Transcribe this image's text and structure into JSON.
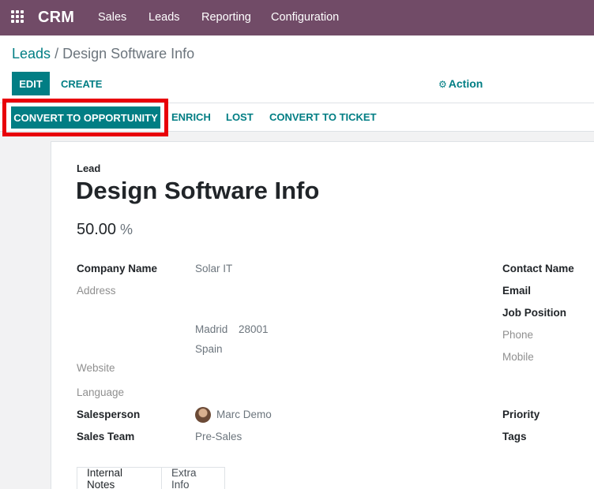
{
  "navbar": {
    "brand": "CRM",
    "items": [
      "Sales",
      "Leads",
      "Reporting",
      "Configuration"
    ]
  },
  "breadcrumb": {
    "parent": "Leads",
    "separator": "/",
    "current": "Design Software Info"
  },
  "toolbar": {
    "edit_label": "EDIT",
    "create_label": "CREATE",
    "action_label": "Action"
  },
  "statusbar": {
    "convert_label": "CONVERT TO OPPORTUNITY",
    "enrich_label": "ENRICH",
    "lost_label": "LOST",
    "ticket_label": "CONVERT TO TICKET"
  },
  "form": {
    "type_label": "Lead",
    "name": "Design Software Info",
    "probability": "50.00",
    "probability_unit": "%",
    "company_name_label": "Company Name",
    "company_name": "Solar IT",
    "address_label": "Address",
    "city": "Madrid",
    "zip": "28001",
    "country": "Spain",
    "website_label": "Website",
    "language_label": "Language",
    "salesperson_label": "Salesperson",
    "salesperson": "Marc Demo",
    "sales_team_label": "Sales Team",
    "sales_team": "Pre-Sales",
    "contact_name_label": "Contact Name",
    "email_label": "Email",
    "job_position_label": "Job Position",
    "phone_label": "Phone",
    "mobile_label": "Mobile",
    "priority_label": "Priority",
    "tags_label": "Tags"
  },
  "tabs": [
    "Internal Notes",
    "Extra Info"
  ],
  "colors": {
    "navbar": "#714b67",
    "primary": "#017e84",
    "highlight": "#e8000a"
  }
}
